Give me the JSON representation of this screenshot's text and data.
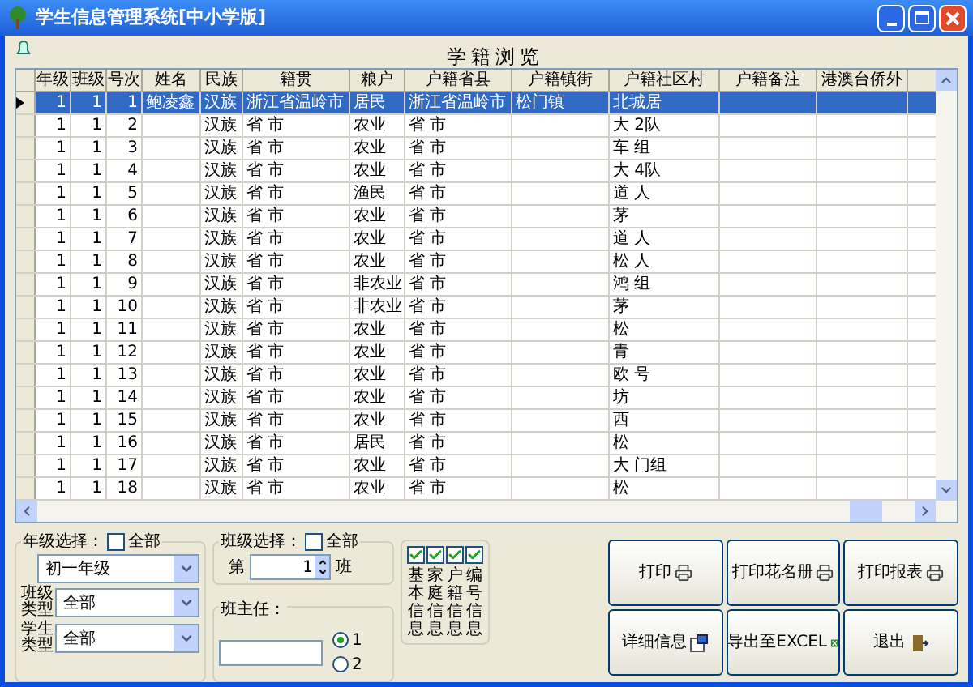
{
  "window": {
    "title": "学生信息管理系统[中小学版]"
  },
  "heading": "学籍浏览",
  "table": {
    "columns": [
      "年级",
      "班级",
      "号次",
      "姓名",
      "民族",
      "籍贯",
      "粮户",
      "户籍省县",
      "户籍镇街",
      "户籍社区村",
      "户籍备注",
      "港澳台侨外"
    ],
    "rows": [
      {
        "selected": true,
        "cells": [
          "1",
          "1",
          "1",
          "鲍凌鑫",
          "汉族",
          "浙江省温岭市",
          "居民",
          "浙江省温岭市",
          "松门镇",
          "北城居",
          null,
          null
        ]
      },
      {
        "selected": false,
        "cells": [
          "1",
          "1",
          "2",
          null,
          "汉族",
          "省 市",
          "农业",
          "省 市",
          null,
          "大 2队",
          null,
          null
        ]
      },
      {
        "selected": false,
        "cells": [
          "1",
          "1",
          "3",
          null,
          "汉族",
          "省 市",
          "农业",
          "省 市",
          null,
          "车 组",
          null,
          null
        ]
      },
      {
        "selected": false,
        "cells": [
          "1",
          "1",
          "4",
          null,
          "汉族",
          "省 市",
          "农业",
          "省 市",
          null,
          "大 4队",
          null,
          null
        ]
      },
      {
        "selected": false,
        "cells": [
          "1",
          "1",
          "5",
          null,
          "汉族",
          "省 市",
          "渔民",
          "省 市",
          null,
          "道 人",
          null,
          null
        ]
      },
      {
        "selected": false,
        "cells": [
          "1",
          "1",
          "6",
          null,
          "汉族",
          "省 市",
          "农业",
          "省 市",
          null,
          "茅",
          null,
          null
        ]
      },
      {
        "selected": false,
        "cells": [
          "1",
          "1",
          "7",
          null,
          "汉族",
          "省 市",
          "农业",
          "省 市",
          null,
          "道 人",
          null,
          null
        ]
      },
      {
        "selected": false,
        "cells": [
          "1",
          "1",
          "8",
          null,
          "汉族",
          "省 市",
          "农业",
          "省 市",
          null,
          "松 人",
          null,
          null
        ]
      },
      {
        "selected": false,
        "cells": [
          "1",
          "1",
          "9",
          null,
          "汉族",
          "省 市",
          "非农业",
          "省 市",
          null,
          "鸿 组",
          null,
          null
        ]
      },
      {
        "selected": false,
        "cells": [
          "1",
          "1",
          "10",
          null,
          "汉族",
          "省 市",
          "非农业",
          "省 市",
          null,
          "茅",
          null,
          null
        ]
      },
      {
        "selected": false,
        "cells": [
          "1",
          "1",
          "11",
          null,
          "汉族",
          "省 市",
          "农业",
          "省 市",
          null,
          "松",
          null,
          null
        ]
      },
      {
        "selected": false,
        "cells": [
          "1",
          "1",
          "12",
          null,
          "汉族",
          "省 市",
          "农业",
          "省 市",
          null,
          "青",
          null,
          null
        ]
      },
      {
        "selected": false,
        "cells": [
          "1",
          "1",
          "13",
          null,
          "汉族",
          "省 市",
          "农业",
          "省 市",
          null,
          "欧 号",
          null,
          null
        ]
      },
      {
        "selected": false,
        "cells": [
          "1",
          "1",
          "14",
          null,
          "汉族",
          "省 市",
          "农业",
          "省 市",
          null,
          "坊",
          null,
          null
        ]
      },
      {
        "selected": false,
        "cells": [
          "1",
          "1",
          "15",
          null,
          "汉族",
          "省 市",
          "农业",
          "省 市",
          null,
          "西",
          null,
          null
        ]
      },
      {
        "selected": false,
        "cells": [
          "1",
          "1",
          "16",
          null,
          "汉族",
          "省 市",
          "居民",
          "省 市",
          null,
          "松",
          null,
          null
        ]
      },
      {
        "selected": false,
        "cells": [
          "1",
          "1",
          "17",
          null,
          "汉族",
          "省 市",
          "农业",
          "省 市",
          null,
          "大 门组",
          null,
          null
        ]
      },
      {
        "selected": false,
        "cells": [
          "1",
          "1",
          "18",
          null,
          "汉族",
          "省 市",
          "农业",
          "省 市",
          null,
          "松",
          null,
          null
        ]
      }
    ]
  },
  "grade_group": {
    "label": "年级选择：",
    "all_label": "全部",
    "all_checked": false,
    "grade": "初一年级",
    "class_type_label": "班级类型",
    "class_type": "全部",
    "student_type_label": "学生类型",
    "student_type": "全部"
  },
  "class_group": {
    "label": "班级选择：",
    "all_label": "全部",
    "all_checked": false,
    "prefix": "第",
    "value": "1",
    "suffix": "班"
  },
  "teacher_group": {
    "label": "班主任：",
    "options": [
      {
        "label": "1",
        "selected": true
      },
      {
        "label": "2",
        "selected": false
      }
    ]
  },
  "info_checks": [
    {
      "label": "基本信息",
      "checked": true
    },
    {
      "label": "家庭信息",
      "checked": true
    },
    {
      "label": "户籍信息",
      "checked": true
    },
    {
      "label": "编号信息",
      "checked": true
    }
  ],
  "buttons": [
    {
      "label": "打印",
      "kind": "print"
    },
    {
      "label": "打印花名册",
      "kind": "print"
    },
    {
      "label": "打印报表",
      "kind": "print"
    },
    {
      "label": "详细信息",
      "kind": "details"
    },
    {
      "label": "导出至EXCEL",
      "kind": "excel"
    },
    {
      "label": "退出",
      "kind": "exit"
    }
  ]
}
